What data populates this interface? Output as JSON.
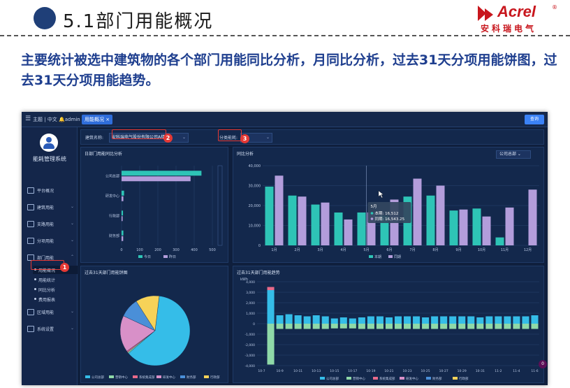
{
  "slide": {
    "title": "5.1部门用能概况",
    "description": "主要统计被选中建筑物的各个部门用能同比分析，月同比分析，过去31天分项用能饼图，过去31天分项用能趋势。",
    "logo_en": "Acrel",
    "logo_cn": "安科瑞电气",
    "logo_reg": "®"
  },
  "topbar": {
    "menu_icon": "hamburger-icon",
    "text_theme": "主题",
    "text_lang": "中文",
    "bell_icon": "bell-icon",
    "user": "admin",
    "tab_label": "用能概况",
    "query_label": "查询"
  },
  "sidebar": {
    "system_name": "能耗管理系统",
    "items": [
      {
        "label": "平台概况",
        "icon": "monitor-icon"
      },
      {
        "label": "建筑用能",
        "icon": "building-icon"
      },
      {
        "label": "支路用能",
        "icon": "branch-icon"
      },
      {
        "label": "分项用能",
        "icon": "itemized-icon"
      },
      {
        "label": "部门用能",
        "icon": "department-icon"
      },
      {
        "label": "区域用能",
        "icon": "region-icon"
      },
      {
        "label": "系统设置",
        "icon": "settings-icon"
      }
    ],
    "subitems": [
      "用能概况",
      "用能统计",
      "同比分析",
      "费用报表"
    ]
  },
  "filter": {
    "building_label": "建筑名称:",
    "building_value": "安科瑞电气股份有限公司A楼",
    "type_label": "分类能耗:",
    "type_value": "电"
  },
  "annotations": [
    "1",
    "2",
    "3"
  ],
  "colors": {
    "teal": "#2ec4b6",
    "purple": "#b39ddb",
    "bg": "#0f1f3d",
    "panel": "#13284c"
  },
  "panels": {
    "dept_title": "日部门用能同比分析",
    "month_title": "同比分析",
    "month_dropdown": "公司总部",
    "pie_title": "过去31天部门用能饼图",
    "trend_title": "过去31天部门用能趋势",
    "trend_unit": "kWh",
    "tooltip_title": "5月",
    "tooltip_line1": "本期: 16,512",
    "tooltip_line2": "同期: 16,543.25",
    "corner_badge": "0"
  },
  "chart_data": [
    {
      "type": "bar",
      "orientation": "horizontal",
      "categories": [
        "公司总部",
        "研发中心",
        "行政部",
        "财务部"
      ],
      "series": [
        {
          "name": "今日",
          "values": [
            440,
            14,
            8,
            10
          ]
        },
        {
          "name": "昨日",
          "values": [
            380,
            10,
            6,
            9
          ]
        }
      ],
      "xlim": [
        0,
        500
      ],
      "xticks": [
        "0",
        "100",
        "200",
        "300",
        "400",
        "500"
      ]
    },
    {
      "type": "bar",
      "categories": [
        "1月",
        "2月",
        "3月",
        "4月",
        "5月",
        "6月",
        "7月",
        "8月",
        "9月",
        "10月",
        "11月",
        "12月"
      ],
      "series": [
        {
          "name": "本期",
          "values": [
            29500,
            25000,
            20500,
            16500,
            16512,
            15000,
            24500,
            25000,
            17500,
            18500,
            4000,
            0
          ]
        },
        {
          "name": "同期",
          "values": [
            35000,
            24500,
            21500,
            13000,
            16543.25,
            23000,
            33500,
            30000,
            18000,
            14500,
            19000,
            28000
          ]
        }
      ],
      "ylim": [
        0,
        40000
      ],
      "yticks": [
        "0",
        "10,000",
        "20,000",
        "30,000",
        "40,000"
      ]
    },
    {
      "type": "pie",
      "labels": [
        "公司总部",
        "营销中心",
        "系统集成部",
        "研发中心",
        "财务部",
        "行政部"
      ],
      "values": [
        62,
        0.6,
        0.6,
        17,
        9,
        11
      ],
      "colors": [
        "#35bde8",
        "#8fd9a8",
        "#e86a8a",
        "#d890c8",
        "#4a8fd8",
        "#f6d258"
      ]
    },
    {
      "type": "bar",
      "stacked": true,
      "categories": [
        "10-7",
        "10-9",
        "10-11",
        "10-13",
        "10-15",
        "10-17",
        "10-19",
        "10-21",
        "10-23",
        "10-25",
        "10-27",
        "10-29",
        "10-31",
        "11-2",
        "11-4",
        "11-6"
      ],
      "ylim": [
        -4000,
        4000
      ],
      "yticks": [
        "-4,000",
        "-3,000",
        "-2,000",
        "-1,000",
        "0",
        "1,000",
        "2,000",
        "3,000",
        "4,000"
      ],
      "legend": [
        "公司总部",
        "营销中心",
        "系统集成部",
        "研发中心",
        "财务部",
        "行政部"
      ],
      "series": [
        {
          "name": "公司总部",
          "values": [
            0,
            3200,
            800,
            900,
            800,
            700,
            800,
            700,
            500,
            600,
            500,
            600,
            700,
            700,
            600,
            700,
            700,
            700,
            600,
            700,
            700,
            700,
            700,
            700,
            600,
            700,
            700,
            700,
            700,
            700,
            800
          ]
        },
        {
          "name": "营销中心",
          "values": [
            0,
            -3900,
            -500,
            -500,
            -500,
            -500,
            -500,
            -500,
            -450,
            -450,
            -450,
            -500,
            -500,
            -500,
            -500,
            -500,
            -500,
            -500,
            -500,
            -500,
            -500,
            -500,
            -500,
            -500,
            -500,
            -500,
            -500,
            -500,
            -500,
            -500,
            -500
          ]
        }
      ]
    }
  ]
}
